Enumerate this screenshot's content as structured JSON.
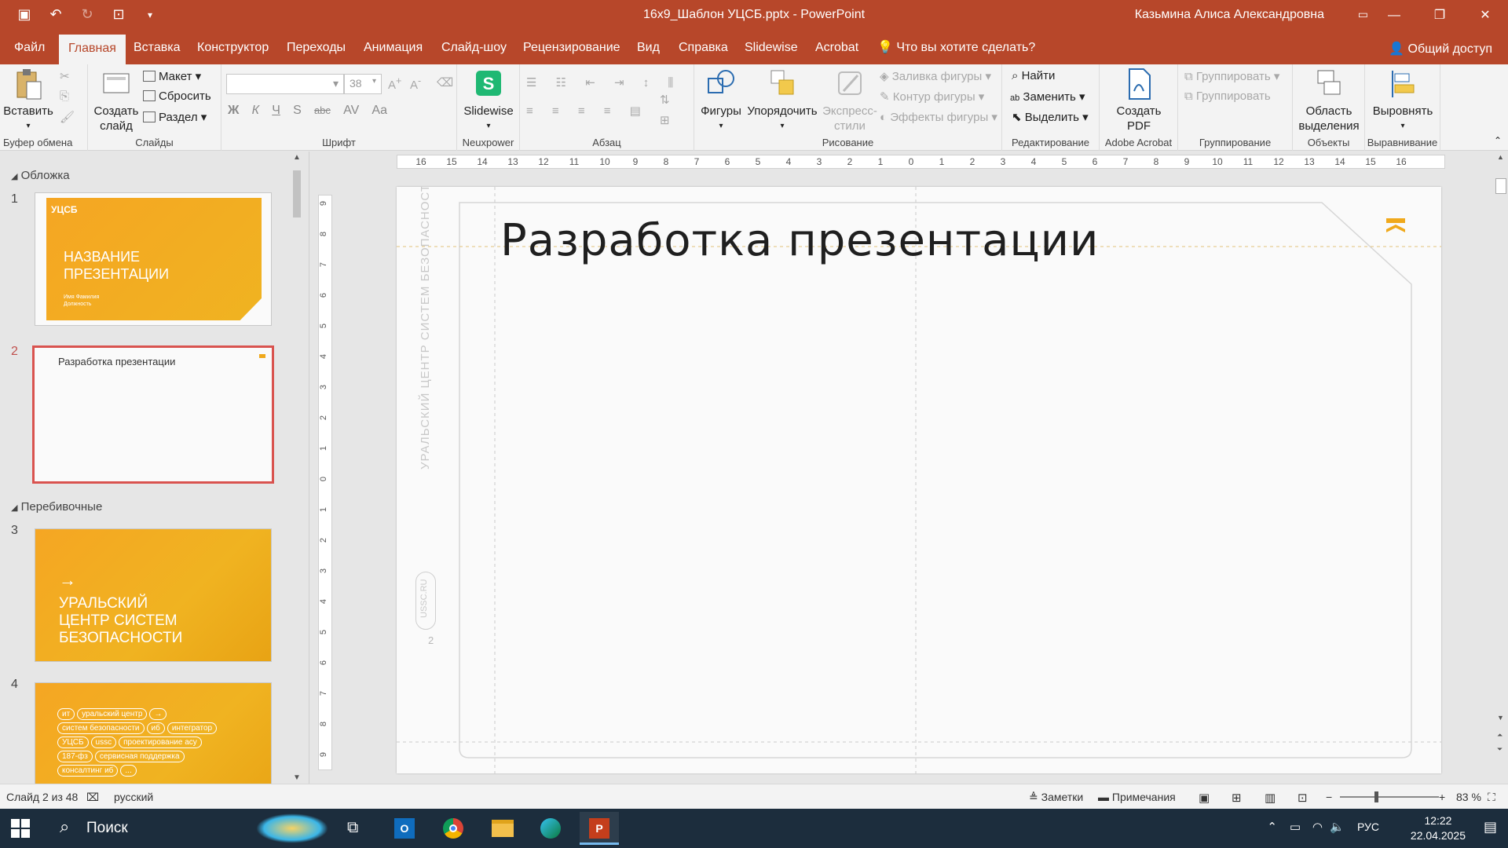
{
  "titlebar": {
    "doc_title": "16x9_Шаблон УЦСБ.pptx  -  PowerPoint",
    "user_name": "Казьмина Алиса Александровна"
  },
  "tabs": [
    {
      "label": "Файл"
    },
    {
      "label": "Главная",
      "active": true
    },
    {
      "label": "Вставка"
    },
    {
      "label": "Конструктор"
    },
    {
      "label": "Переходы"
    },
    {
      "label": "Анимация"
    },
    {
      "label": "Слайд-шоу"
    },
    {
      "label": "Рецензирование"
    },
    {
      "label": "Вид"
    },
    {
      "label": "Справка"
    },
    {
      "label": "Slidewise"
    },
    {
      "label": "Acrobat"
    },
    {
      "label": "Что вы хотите сделать?"
    }
  ],
  "share_label": "Общий доступ",
  "ribbon": {
    "clipboard": {
      "paste": "Вставить",
      "group": "Буфер обмена"
    },
    "slides": {
      "new_slide_1": "Создать",
      "new_slide_2": "слайд",
      "layout": "Макет",
      "reset": "Сбросить",
      "section": "Раздел",
      "group": "Слайды"
    },
    "font": {
      "font_size": "38",
      "group": "Шрифт",
      "buttons": [
        "Ж",
        "К",
        "Ч",
        "S",
        "abc",
        "AV",
        "Aa"
      ]
    },
    "neuxpower": {
      "slidewise": "Slidewise",
      "group": "Neuxpower"
    },
    "paragraph": {
      "group": "Абзац"
    },
    "drawing": {
      "shapes": "Фигуры",
      "arrange": "Упорядочить",
      "quick_styles_1": "Экспресс-",
      "quick_styles_2": "стили",
      "fill": "Заливка фигуры",
      "outline": "Контур фигуры",
      "effects": "Эффекты фигуры",
      "group": "Рисование"
    },
    "editing": {
      "find": "Найти",
      "replace": "Заменить",
      "select": "Выделить",
      "group": "Редактирование"
    },
    "acrobat": {
      "create_pdf_1": "Создать",
      "create_pdf_2": "PDF",
      "group": "Adobe Acrobat"
    },
    "grouping": {
      "group_btn": "Группировать",
      "ungroup_btn": "Группировать",
      "group": "Группирование"
    },
    "objects": {
      "selection_pane_1": "Область",
      "selection_pane_2": "выделения",
      "group": "Объекты"
    },
    "align": {
      "align_btn": "Выровнять",
      "group": "Выравнивание"
    }
  },
  "thumbs": {
    "section_1": "Обложка",
    "section_2": "Перебивочные",
    "slide1": {
      "num": "1",
      "logo": "УЦСБ",
      "title_1": "НАЗВАНИЕ",
      "title_2": "ПРЕЗЕНТАЦИИ",
      "name": "Имя Фамилия",
      "position": "Должность"
    },
    "slide2": {
      "num": "2",
      "title": "Разработка презентации"
    },
    "slide3": {
      "num": "3",
      "arrow": "→",
      "line_1": "УРАЛЬСКИЙ",
      "line_2": "ЦЕНТР СИСТЕМ",
      "line_3": "БЕЗОПАСНОСТИ"
    },
    "slide4": {
      "num": "4",
      "tags": [
        "ит",
        "уральский центр",
        "→",
        "систем безопасности",
        "иб",
        "интегратор",
        "УЦСБ",
        "ussc",
        "проектирование асу",
        "187-фз",
        "сервисная поддержка",
        "консалтинг иб",
        "..."
      ]
    }
  },
  "slide": {
    "title": "Разработка презентации",
    "side_text": "УРАЛЬСКИЙ ЦЕНТР СИСТЕМ БЕЗОПАСНОСТИ",
    "ussc": "USSC.RU",
    "page_num": "2"
  },
  "ruler": {
    "h_ticks": [
      "16",
      "15",
      "14",
      "13",
      "12",
      "11",
      "10",
      "9",
      "8",
      "7",
      "6",
      "5",
      "4",
      "3",
      "2",
      "1",
      "0",
      "1",
      "2",
      "3",
      "4",
      "5",
      "6",
      "7",
      "8",
      "9",
      "10",
      "11",
      "12",
      "13",
      "14",
      "15",
      "16"
    ],
    "v_ticks": [
      "9",
      "8",
      "7",
      "6",
      "5",
      "4",
      "3",
      "2",
      "1",
      "0",
      "1",
      "2",
      "3",
      "4",
      "5",
      "6",
      "7",
      "8",
      "9"
    ]
  },
  "status": {
    "slide_info": "Слайд 2 из 48",
    "language": "русский",
    "notes": "Заметки",
    "comments": "Примечания",
    "zoom": "83 %"
  },
  "taskbar": {
    "search": "Поиск",
    "lang": "РУС",
    "time": "12:22",
    "date": "22.04.2025"
  },
  "colors": {
    "accent": "#b7472a",
    "brand_orange": "#f0a91c",
    "selection": "#d9534f"
  }
}
